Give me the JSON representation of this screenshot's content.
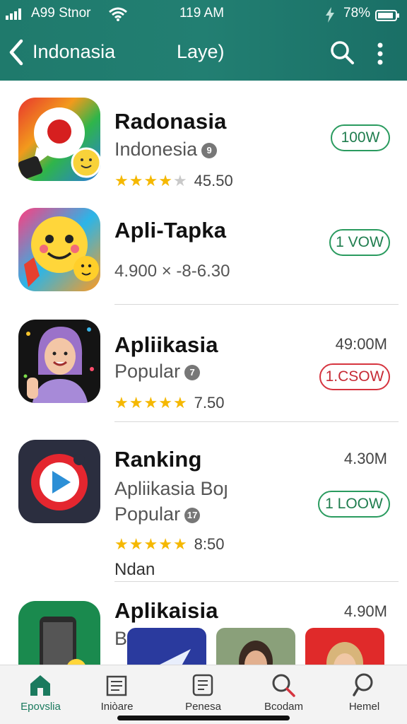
{
  "status_bar": {
    "carrier": "A99 Stnor",
    "time": "119 AM",
    "battery": "78%"
  },
  "nav": {
    "back_label": "Indonasia",
    "center_title": "Laye)"
  },
  "apps": [
    {
      "name": "Radonasia",
      "subtitle": "Indonesia",
      "badge": "9",
      "stars": 4,
      "rating": "45.50",
      "button": "100W",
      "button_color": "#2a9b5f"
    },
    {
      "name": "Apli-Tapka",
      "subtitle": "4.900 × -8-6.30",
      "button": "1 VOW",
      "button_color": "#2a9b5f"
    },
    {
      "name": "Apliikasia",
      "subtitle": "Popular",
      "badge": "7",
      "stars": 5,
      "rating": "7.50",
      "size": "49:00M",
      "button": "1.CSOW",
      "button_color": "#d6343f"
    },
    {
      "name": "Ranking",
      "subtitle": "Apliikasia Boȷ",
      "subtitle2": "Popular",
      "badge": "17",
      "stars": 5,
      "rating": "8:50",
      "extra": "Ndan",
      "size": "4.30M",
      "button": "1 LOOW",
      "button_color": "#2a9b5f"
    },
    {
      "name": "Aplikaisia",
      "subtitle": "B",
      "size": "4.90M"
    }
  ],
  "tabs": [
    {
      "label": "Epovslia",
      "icon": "home-icon",
      "active": true
    },
    {
      "label": "Iniòare",
      "icon": "newspaper-icon"
    },
    {
      "label": "Penesa",
      "icon": "list-icon"
    },
    {
      "label": "Bcodam",
      "icon": "search-icon"
    },
    {
      "label": "Hemel",
      "icon": "search-icon"
    }
  ],
  "colors": {
    "header": "#1f7a6c",
    "accent_green": "#2a9b5f",
    "accent_red": "#d6343f",
    "star": "#f5b800"
  }
}
